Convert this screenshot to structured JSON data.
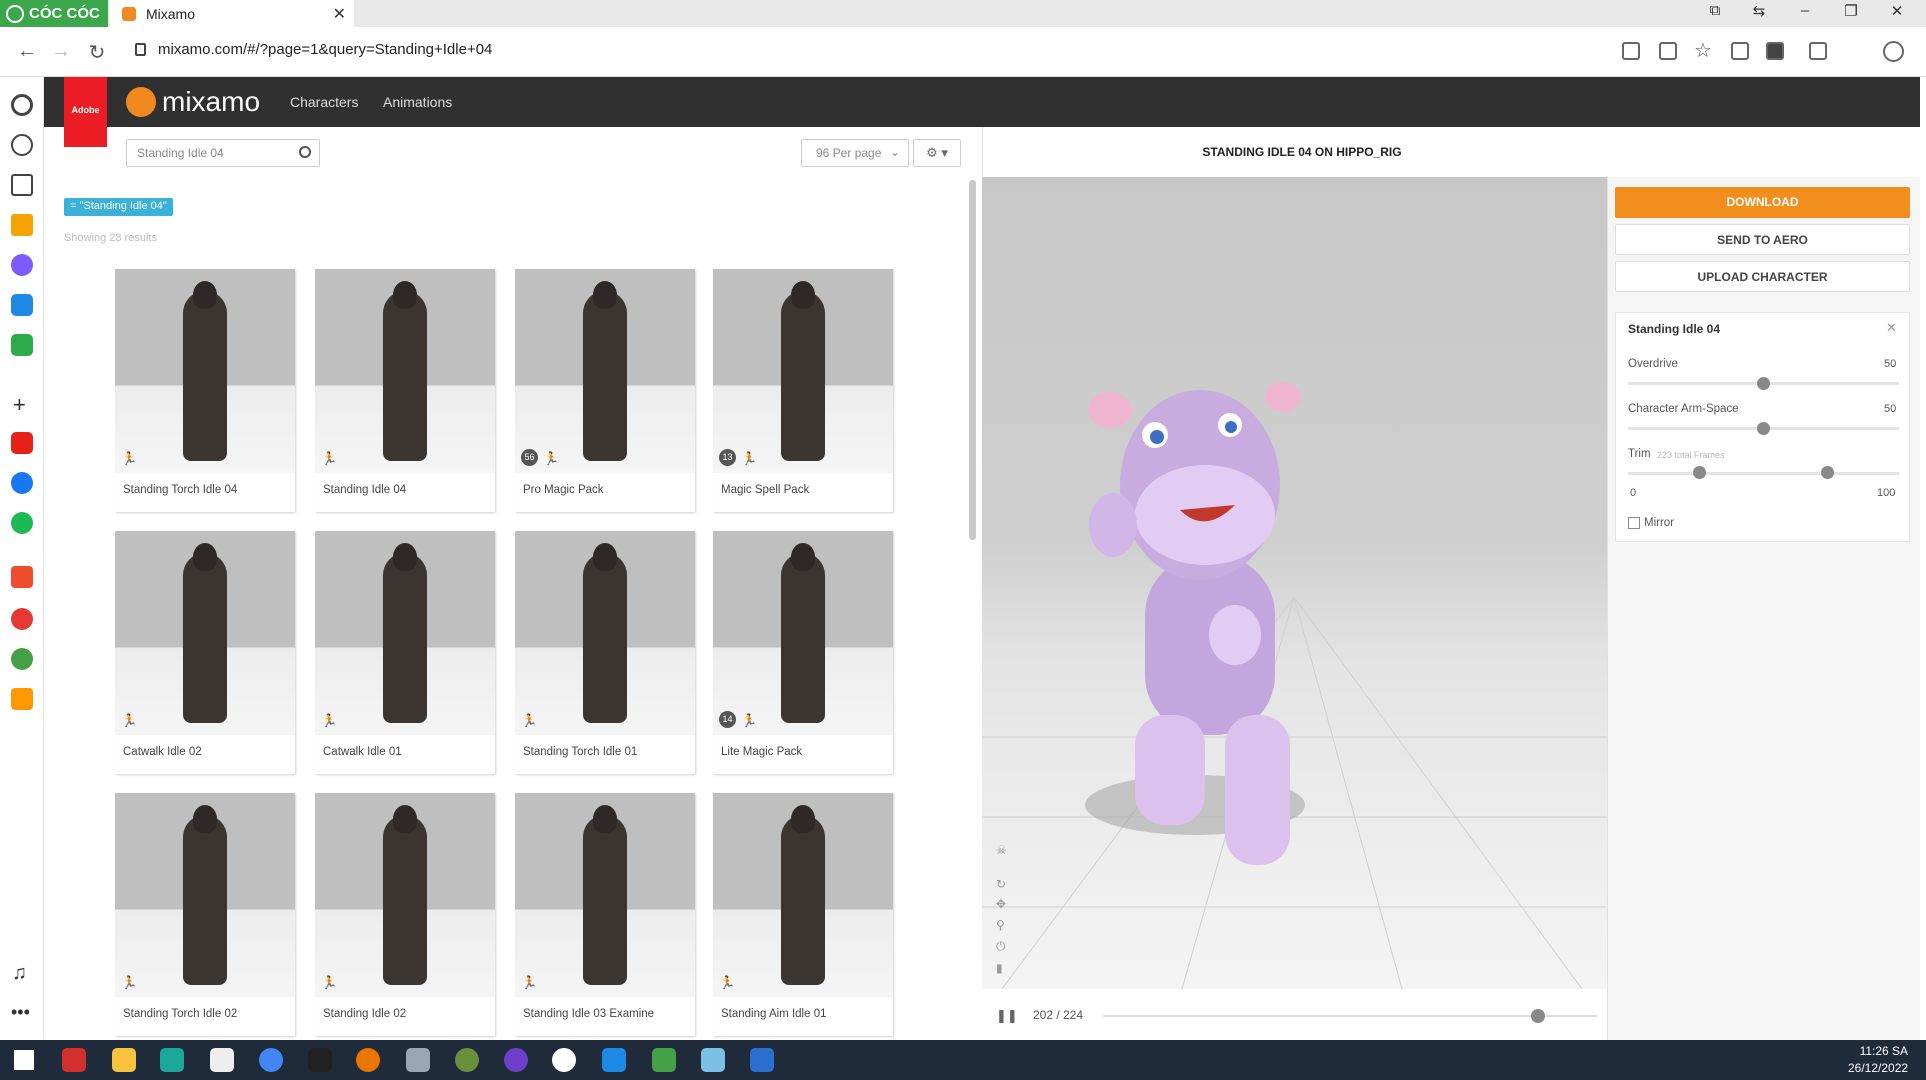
{
  "browser": {
    "brand": "CÓC CÓC",
    "tab_title": "Mixamo",
    "url": "mixamo.com/#/?page=1&query=Standing+Idle+04"
  },
  "mixamo": {
    "adobe": "Adobe",
    "logo": "mixamo",
    "nav": [
      "Characters",
      "Animations"
    ],
    "search_value": "Standing Idle 04",
    "per_page": "96 Per page",
    "filter_tag": "= \"Standing Idle 04\"",
    "results": "Showing 28 results"
  },
  "cards": [
    {
      "label": "Standing Torch Idle 04",
      "badge": ""
    },
    {
      "label": "Standing Idle 04",
      "badge": ""
    },
    {
      "label": "Pro Magic Pack",
      "badge": "56"
    },
    {
      "label": "Magic Spell Pack",
      "badge": "13"
    },
    {
      "label": "Catwalk Idle 02",
      "badge": ""
    },
    {
      "label": "Catwalk Idle 01",
      "badge": ""
    },
    {
      "label": "Standing Torch Idle 01",
      "badge": ""
    },
    {
      "label": "Lite Magic Pack",
      "badge": "14"
    },
    {
      "label": "Standing Torch Idle 02",
      "badge": ""
    },
    {
      "label": "Standing Idle 02",
      "badge": ""
    },
    {
      "label": "Standing Idle 03 Examine",
      "badge": ""
    },
    {
      "label": "Standing Aim Idle 01",
      "badge": ""
    }
  ],
  "viewer": {
    "title": "STANDING IDLE 04 ON HIPPO_RIG",
    "frame": "202 / 224",
    "progress": 0.88
  },
  "panel": {
    "download": "DOWNLOAD",
    "send_to_aero": "SEND TO AERO",
    "upload": "UPLOAD CHARACTER",
    "anim_name": "Standing Idle 04",
    "overdrive_label": "Overdrive",
    "overdrive_value": "50",
    "armspace_label": "Character Arm-Space",
    "armspace_value": "50",
    "trim_label": "Trim",
    "trim_note": "223 total Frames",
    "trim_min": "0",
    "trim_max": "100",
    "mirror": "Mirror"
  },
  "taskbar": {
    "time": "11:26 SA",
    "date": "26/12/2022"
  },
  "colors": {
    "accent": "#f18e1e",
    "header": "#303030",
    "tag": "#39b1d8",
    "adobe": "#eb1c24"
  }
}
